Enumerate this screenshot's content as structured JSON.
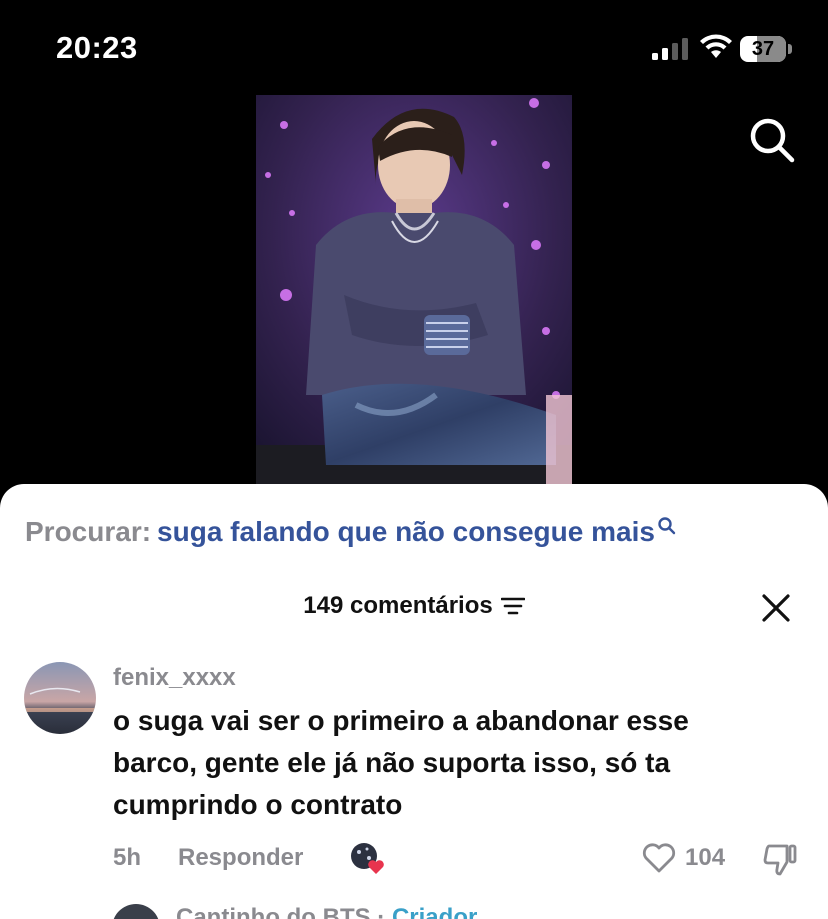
{
  "status_bar": {
    "time": "20:23",
    "battery_level": "37"
  },
  "search": {
    "label": "Procurar:",
    "query": "suga falando que não consegue mais"
  },
  "comments_header": {
    "count_label": "149 comentários"
  },
  "comment": {
    "username": "fenix_xxxx",
    "text": "o suga vai ser o primeiro a abandonar esse barco, gente ele já não suporta isso, só ta cumprindo o contrato",
    "time_ago": "5h",
    "reply_label": "Responder",
    "likes": "104"
  },
  "next_comment": {
    "username": "Cantinho do BTS",
    "separator": " · ",
    "creator_label": "Criador"
  },
  "colors": {
    "accent_query": "#35539a",
    "muted": "#8a8a8f",
    "heart_red": "#e8344e",
    "creator_blue": "#3aa0c8"
  }
}
